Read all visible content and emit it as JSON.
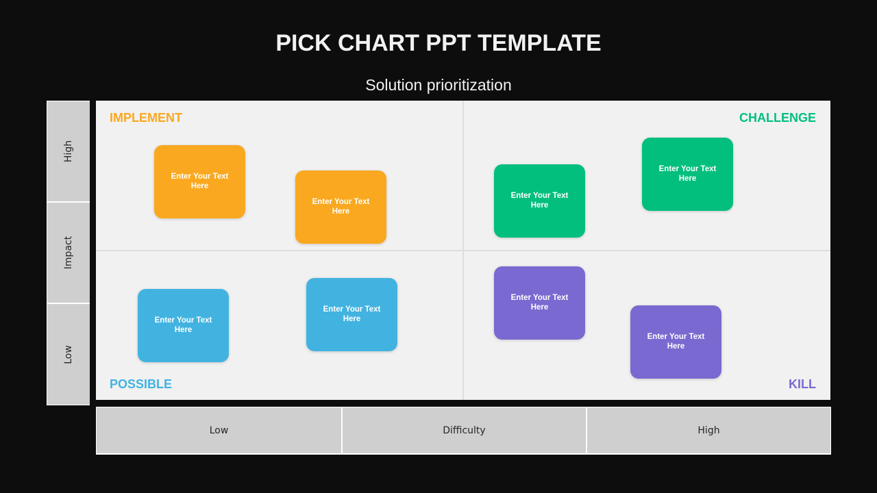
{
  "header": {
    "title": "PICK CHART PPT TEMPLATE",
    "subtitle": "Solution prioritization"
  },
  "colors": {
    "background": "#0d0d0d",
    "panel": "#f1f1f1",
    "axis_cell": "#d0cfcf",
    "implement": "#f9a81f",
    "challenge": "#02bf7e",
    "possible": "#42b3e0",
    "kill": "#7a69d0"
  },
  "quadrants": {
    "implement": {
      "label": "IMPLEMENT",
      "cards": [
        {
          "text": "Enter Your Text Here"
        },
        {
          "text": "Enter Your Text Here"
        }
      ]
    },
    "challenge": {
      "label": "CHALLENGE",
      "cards": [
        {
          "text": "Enter Your Text Here"
        },
        {
          "text": "Enter Your Text Here"
        }
      ]
    },
    "possible": {
      "label": "POSSIBLE",
      "cards": [
        {
          "text": "Enter Your Text Here"
        },
        {
          "text": "Enter Your Text Here"
        }
      ]
    },
    "kill": {
      "label": "KILL",
      "cards": [
        {
          "text": "Enter Your Text Here"
        },
        {
          "text": "Enter Your Text Here"
        }
      ]
    }
  },
  "y_axis": {
    "high": "High",
    "title": "Impact",
    "low": "Low"
  },
  "x_axis": {
    "low": "Low",
    "title": "Difficulty",
    "high": "High"
  }
}
